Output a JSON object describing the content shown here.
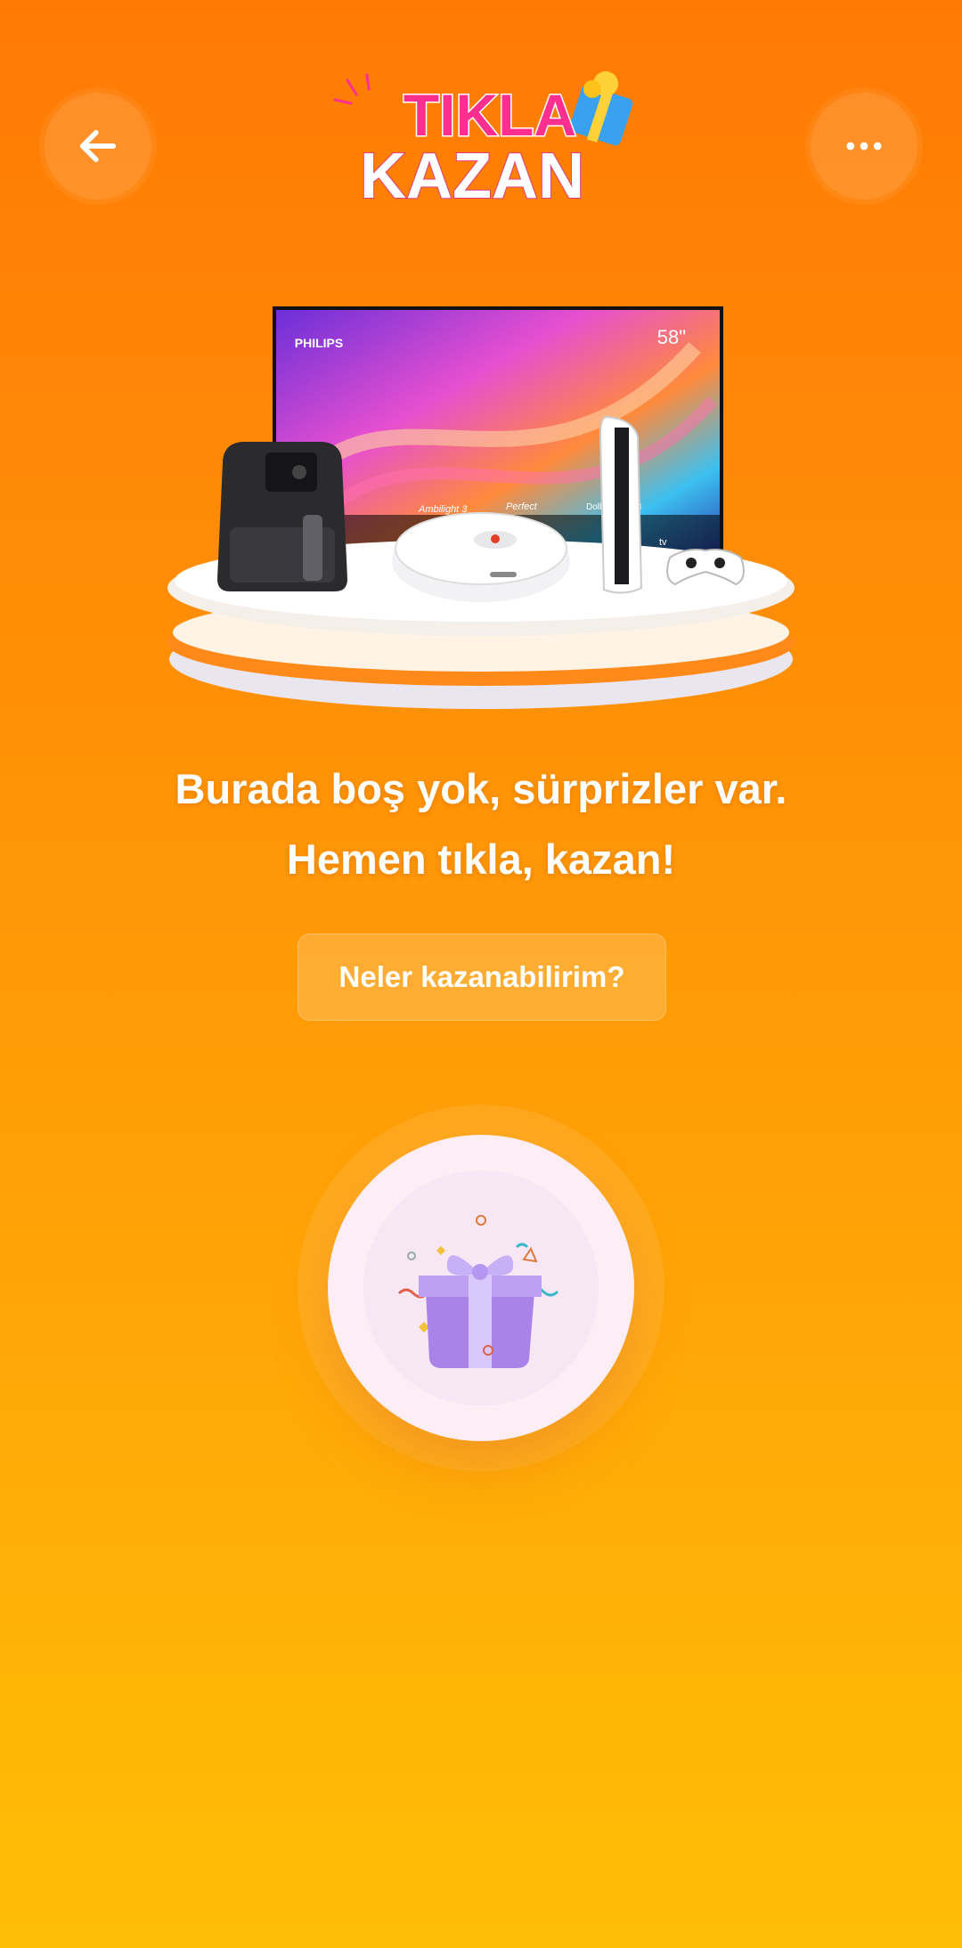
{
  "header": {
    "back_icon": "arrow-left-icon",
    "more_icon": "more-horizontal-icon",
    "logo": {
      "line1": "TIKLA",
      "line2": "KAZAN"
    }
  },
  "hero": {
    "tv_brand": "PHILIPS",
    "tv_size": "58\"",
    "tv_features": [
      "Ambilight 3",
      "Perfect",
      "Dolby VISION",
      "tv"
    ]
  },
  "main": {
    "headline_line1": "Burada boş yok, sürprizler var.",
    "headline_line2": "Hemen tıkla, kazan!",
    "info_button_label": "Neler kazanabilirim?",
    "gift_icon": "gift-box-icon"
  },
  "colors": {
    "bg_top": "#ff7a05",
    "bg_bottom": "#ffbe06",
    "logo_pink": "#ff2f8f",
    "gift_purple": "#a983e8"
  }
}
